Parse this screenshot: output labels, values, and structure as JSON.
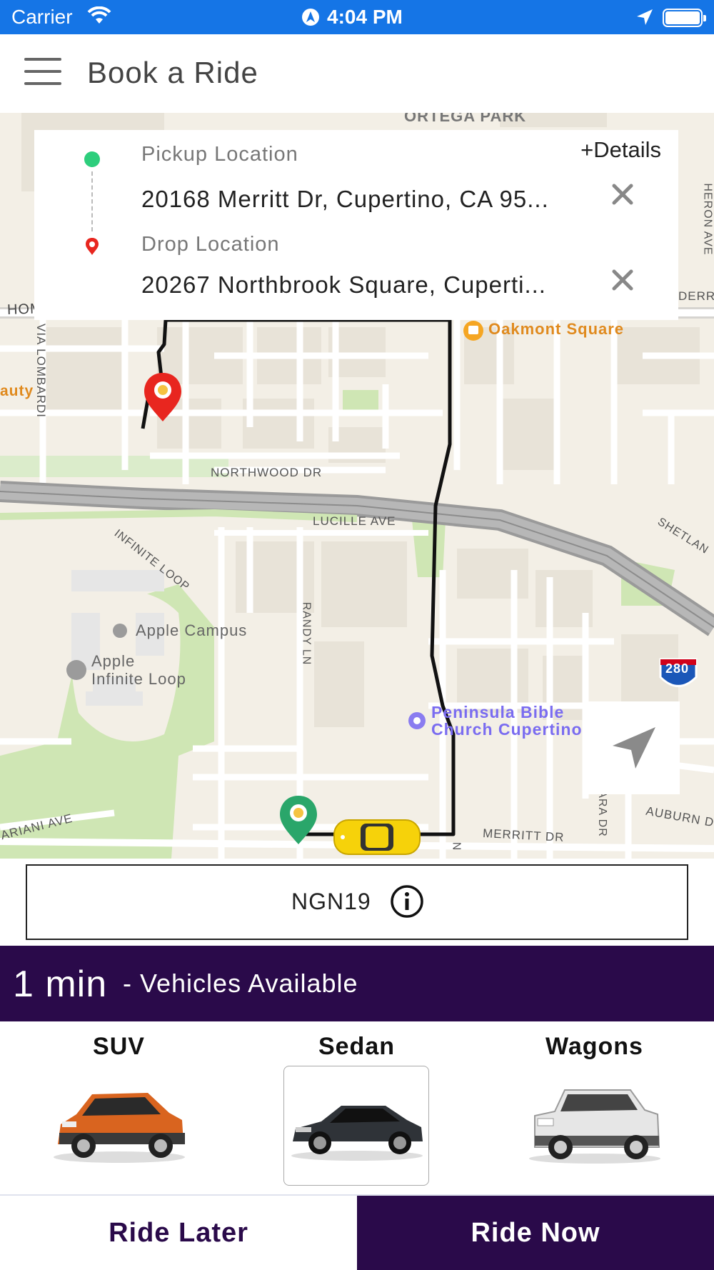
{
  "status_bar": {
    "carrier": "Carrier",
    "time": "4:04 PM",
    "icons": [
      "wifi-icon",
      "navigation-icon",
      "location-arrow-icon",
      "battery-icon"
    ]
  },
  "header": {
    "title": "Book a Ride",
    "menu_icon": "hamburger-menu-icon"
  },
  "location_card": {
    "details_label": "+Details",
    "pickup_label": "Pickup Location",
    "pickup_address": "20168 Merritt Dr, Cupertino, CA 95...",
    "drop_label": "Drop Location",
    "drop_address": "20267 Northbrook Square, Cuperti..."
  },
  "map": {
    "labels": {
      "ortega_park": "ORTEGA PARK",
      "homestead_rd": "HOMESTEAD RD",
      "oakmont_square": "Oakmont Square",
      "beauty": "auty",
      "via_lombardi": "VIA LOMBARDI",
      "heron_ave": "HERON AVE",
      "derr": "DERR",
      "northwood_dr": "NORTHWOOD DR",
      "lucille_ave": "LUCILLE AVE",
      "shetland": "SHETLAN",
      "infinite_loop": "INFINITE LOOP",
      "apple_campus": "Apple Campus",
      "apple_infinite_loop_1": "Apple",
      "apple_infinite_loop_2": "Infinite Loop",
      "randy_ln": "RANDY LN",
      "peninsula_1": "Peninsula Bible",
      "peninsula_2": "Church Cupertino",
      "i280": "280",
      "auburn_dr": "AUBURN D",
      "ara_dr": "ARA DR",
      "merritt_dr": "MERRITT DR",
      "ariani_ave": "ARIANI AVE",
      "n": "N"
    },
    "route_color": "#111111"
  },
  "promo": {
    "code": "NGN19",
    "info_icon": "info-icon"
  },
  "eta": {
    "time": "1 min",
    "text": "- Vehicles Available"
  },
  "vehicles": [
    {
      "name": "SUV",
      "color": "#d9641f",
      "selected": false
    },
    {
      "name": "Sedan",
      "color": "#2f3338",
      "selected": true
    },
    {
      "name": "Wagons",
      "color": "#e6e6e6",
      "selected": false
    }
  ],
  "actions": {
    "ride_later": "Ride Later",
    "ride_now": "Ride Now"
  },
  "colors": {
    "status_bar": "#1575e6",
    "brand": "#2a0a4a",
    "pickup_green": "#2dce7c",
    "drop_red": "#e8261f",
    "taxi_yellow": "#f6d20a"
  }
}
